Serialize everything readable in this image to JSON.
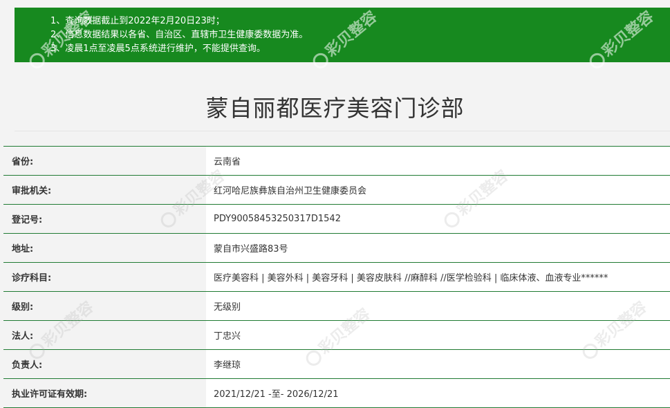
{
  "notice": {
    "lines": [
      "1、查询数据截止到2022年2月20日23时；",
      "2、信息数据结果以各省、自治区、直辖市卫生健康委数据为准。",
      "3、凌晨1点至凌晨5点系统进行维护，不能提供查询。"
    ]
  },
  "title": "蒙自丽都医疗美容门诊部",
  "rows": [
    {
      "label": "省份:",
      "value": "云南省"
    },
    {
      "label": "审批机关:",
      "value": "红河哈尼族彝族自治州卫生健康委员会"
    },
    {
      "label": "登记号:",
      "value": "PDY90058453250317D1542"
    },
    {
      "label": "地址:",
      "value": "蒙自市兴盛路83号"
    },
    {
      "label": "诊疗科目:",
      "value": "医疗美容科 | 美容外科 | 美容牙科 | 美容皮肤科 //麻醉科 //医学检验科 | 临床体液、血液专业******"
    },
    {
      "label": "级别:",
      "value": "无级别"
    },
    {
      "label": "法人:",
      "value": "丁忠兴"
    },
    {
      "label": "负责人:",
      "value": "李继琼"
    },
    {
      "label": "执业许可证有效期:",
      "value": "2021/12/21 -至- 2026/12/21"
    }
  ],
  "watermark": {
    "text": "彩贝整容"
  },
  "colors": {
    "notice_bg": "#17891f",
    "row_border": "#1f7a32"
  }
}
